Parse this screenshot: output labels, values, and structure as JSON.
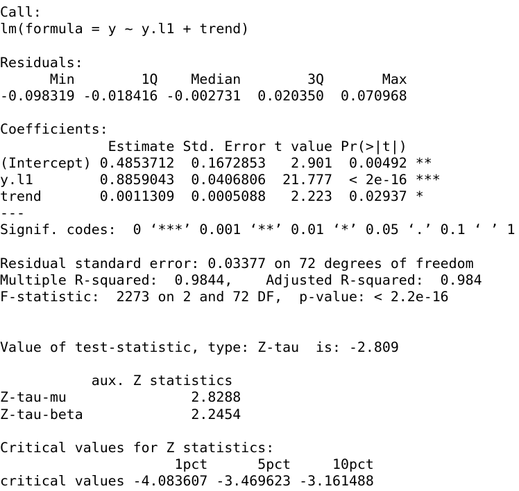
{
  "output": {
    "call_header": "Call:",
    "call_formula": "lm(formula = y ~ y.l1 + trend)",
    "residuals_header": "Residuals:",
    "residuals_labels": "      Min        1Q    Median        3Q       Max ",
    "residuals_values": "-0.098319 -0.018416 -0.002731  0.020350  0.070968 ",
    "coef_header": "Coefficients:",
    "coef_columns": "             Estimate Std. Error t value Pr(>|t|)    ",
    "coef_rows": [
      "(Intercept) 0.4853712  0.1672853   2.901  0.00492 ** ",
      "y.l1        0.8859043  0.0406806  21.777  < 2e-16 ***",
      "trend       0.0011309  0.0005088   2.223  0.02937 *  "
    ],
    "coef_separator": "---",
    "signif_codes": "Signif. codes:  0 ‘***’ 0.001 ‘**’ 0.01 ‘*’ 0.05 ‘.’ 0.1 ‘ ’ 1",
    "rse": "Residual standard error: 0.03377 on 72 degrees of freedom",
    "r_squared": "Multiple R-squared:  0.9844,    Adjusted R-squared:  0.984 ",
    "f_statistic": "F-statistic:  2273 on 2 and 72 DF,  p-value: < 2.2e-16",
    "test_statistic": "Value of test-statistic, type: Z-tau  is: -2.809 ",
    "aux_header": "           aux. Z statistics",
    "aux_rows": [
      "Z-tau-mu               2.8288",
      "Z-tau-beta             2.2454"
    ],
    "critical_header": "Critical values for Z statistics:",
    "critical_labels": "                     1pct      5pct     10pct",
    "critical_values": "critical values -4.083607 -3.469623 -3.161488"
  }
}
